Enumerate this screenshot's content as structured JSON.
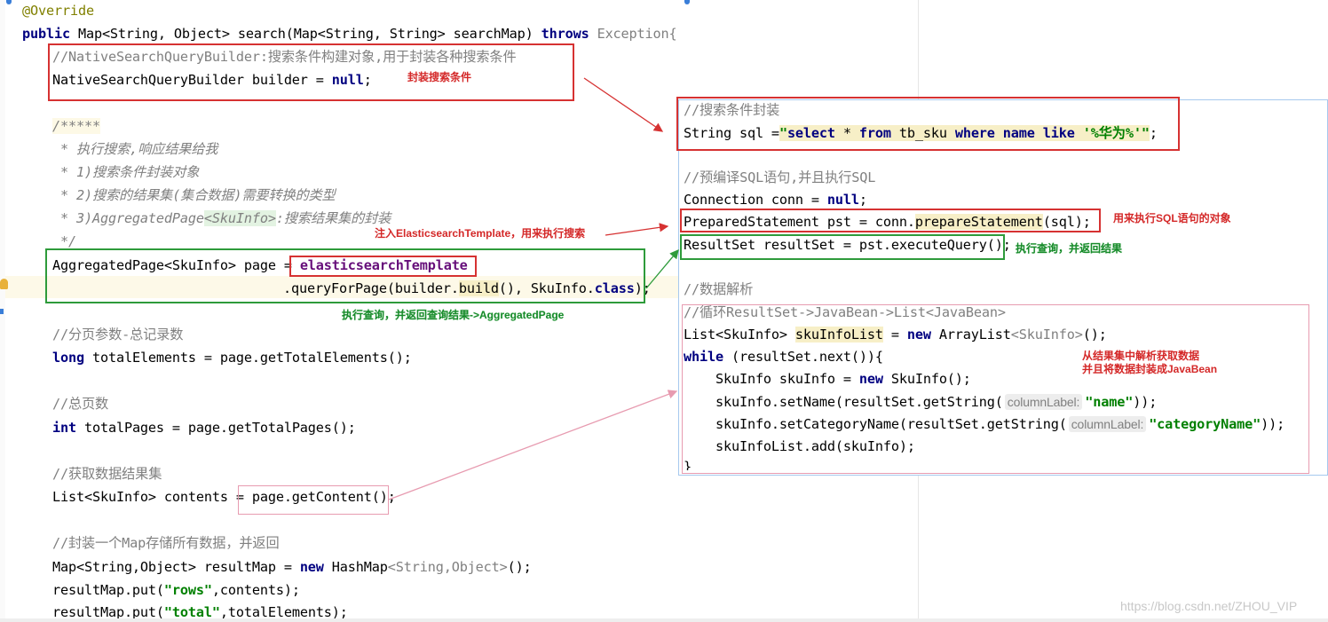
{
  "main_code": {
    "l01": "@Override",
    "l02_kw": "public",
    "l02_rest": " Map<String, Object> search(Map<String, String> searchMap) ",
    "l02_throws": "throws",
    "l02_exc": " Exception{",
    "l03": "//NativeSearchQueryBuilder:搜索条件构建对象,用于封装各种搜索条件",
    "l04_a": "NativeSearchQueryBuilder builder = ",
    "l04_null": "null",
    "l04_end": ";",
    "l06": "/*****",
    "l07": " * 执行搜索,响应结果给我",
    "l08": " * 1)搜索条件封装对象",
    "l09": " * 2)搜索的结果集(集合数据)需要转换的类型",
    "l10_a": " * 3)AggregatedPage",
    "l10_b": "<SkuInfo>",
    "l10_c": ":搜索结果集的封装",
    "l11": " */",
    "l12_a": "AggregatedPage<SkuInfo> page = ",
    "l12_b": "elasticsearchTemplate",
    "l13_a": ".queryForPage(builder.",
    "l13_b": "build",
    "l13_c": "(), SkuInfo.",
    "l13_d": "class",
    "l13_e": ");",
    "l15": "//分页参数-总记录数",
    "l16_kw": "long",
    "l16_rest": " totalElements = page.getTotalElements();",
    "l18": "//总页数",
    "l19_kw": "int",
    "l19_rest": " totalPages = page.getTotalPages();",
    "l21": "//获取数据结果集",
    "l22_a": "List<SkuInfo> contents = ",
    "l22_b": "page.getContent();",
    "l24": "//封装一个Map存储所有数据，并返回",
    "l25_a": "Map<String,Object> resultMap = ",
    "l25_new": "new",
    "l25_b": " HashMap",
    "l25_c": "<String,Object>",
    "l25_d": "();",
    "l26_a": "resultMap.put(",
    "l26_s": "\"rows\"",
    "l26_b": ",contents);",
    "l27_a": "resultMap.put(",
    "l27_s": "\"total\"",
    "l27_b": ",totalElements);"
  },
  "jdbc_code": {
    "c1": "//搜索条件封装",
    "c2_a": "String sql =",
    "c2_q1": "\"",
    "c2_select": "select",
    "c2_b": " * ",
    "c2_from": "from",
    "c2_c": " tb_sku ",
    "c2_where": "where",
    "c2_d": " ",
    "c2_name": "name",
    "c2_e": " ",
    "c2_like": "like",
    "c2_f": " '%华为%'",
    "c2_q2": "\"",
    "c2_end": ";",
    "c4": "//预编译SQL语句,并且执行SQL",
    "c5_a": "Connection conn = ",
    "c5_null": "null",
    "c5_end": ";",
    "c6_a": "PreparedStatement pst = conn.",
    "c6_b": "prepareStatement",
    "c6_c": "(sql);",
    "c7": "ResultSet resultSet = pst.executeQuery();",
    "c9": "//数据解析",
    "c10": "//循环ResultSet->JavaBean->List<JavaBean>",
    "c11_a": "List<SkuInfo> ",
    "c11_b": "skuInfoList",
    "c11_c": " = ",
    "c11_new": "new",
    "c11_d": " ArrayList",
    "c11_e": "<SkuInfo>",
    "c11_f": "();",
    "c12_kw": "while",
    "c12_rest": " (resultSet.next()){",
    "c13_a": "    SkuInfo skuInfo = ",
    "c13_new": "new",
    "c13_b": " SkuInfo();",
    "c14_a": "    skuInfo.setName(resultSet.getString(",
    "c14_hint": "columnLabel:",
    "c14_s": "\"name\"",
    "c14_b": "));",
    "c15_a": "    skuInfo.setCategoryName(resultSet.getString(",
    "c15_hint": "columnLabel:",
    "c15_s": "\"categoryName\"",
    "c15_b": "));",
    "c16": "    skuInfoList.add(skuInfo);",
    "c17": "}"
  },
  "notes": {
    "n1": "封装搜索条件",
    "n2": "注入ElasticsearchTemplate，用来执行搜索",
    "n3": "执行查询，并返回查询结果->AggregatedPage",
    "n4": "用来执行SQL语句的对象",
    "n5": "执行查询，并返回结果",
    "n6a": "从结果集中解析获取数据",
    "n6b": "并且将数据封装成JavaBean",
    "watermark": "https://blog.csdn.net/ZHOU_VIP"
  },
  "colors": {
    "keyword": "#000080",
    "annotation": "#808000",
    "comment": "#808080",
    "string": "#008000",
    "box_red": "#d63232",
    "box_green": "#2e9b3b",
    "box_pink": "#e79bb0"
  }
}
